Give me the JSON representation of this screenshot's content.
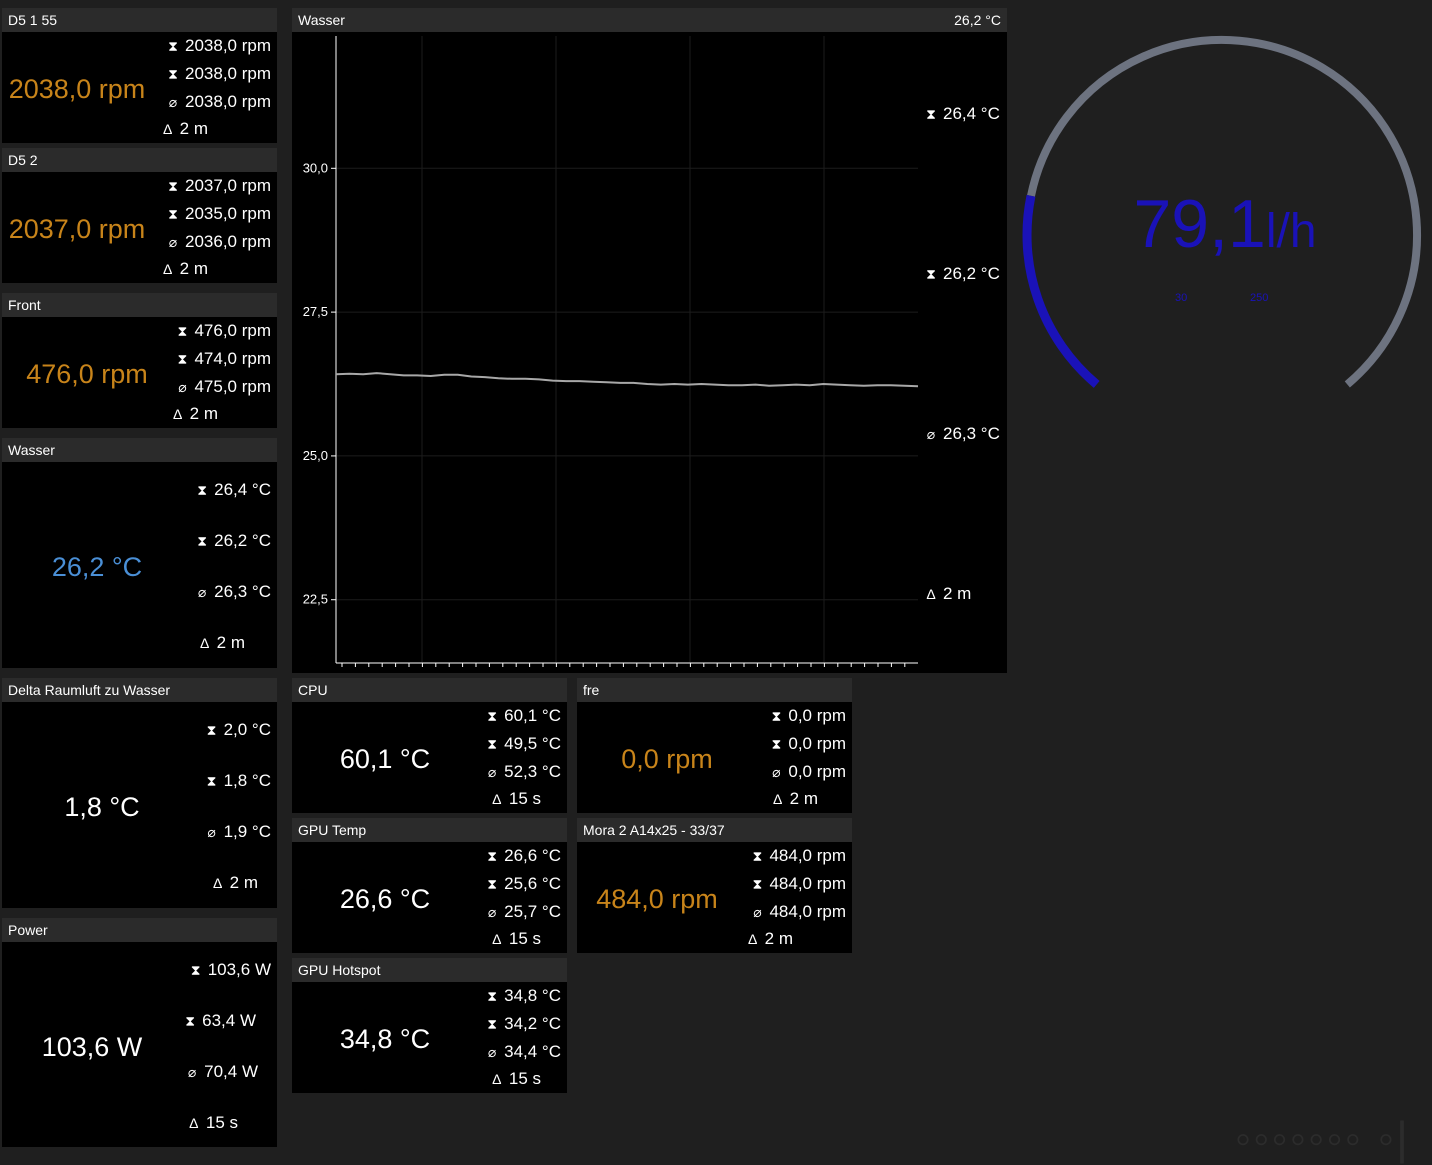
{
  "colors": {
    "rpm": "#c8841a",
    "temp_blue": "#4a8fd6",
    "white": "#ffffff",
    "gauge_fill": "#1a12b8",
    "gauge_track": "#6d7380"
  },
  "icons": {
    "max": "max-hourglass-top-icon",
    "min": "min-hourglass-bottom-icon",
    "avg": "average-diameter-icon",
    "delta": "delta-time-icon"
  },
  "tiles": {
    "d5155": {
      "title": "D5 1 55",
      "value": "2038,0 rpm",
      "max": "2038,0 rpm",
      "min": "2038,0 rpm",
      "avg": "2038,0 rpm",
      "dt": "2 m"
    },
    "d52": {
      "title": "D5 2",
      "value": "2037,0 rpm",
      "max": "2037,0 rpm",
      "min": "2035,0 rpm",
      "avg": "2036,0 rpm",
      "dt": "2 m"
    },
    "front": {
      "title": "Front",
      "value": "476,0 rpm",
      "max": "476,0 rpm",
      "min": "474,0 rpm",
      "avg": "475,0 rpm",
      "dt": "2 m"
    },
    "wasser": {
      "title": "Wasser",
      "value": "26,2 °C",
      "max": "26,4 °C",
      "min": "26,2 °C",
      "avg": "26,3 °C",
      "dt": "2 m"
    },
    "delta": {
      "title": "Delta Raumluft zu Wasser",
      "value": "1,8 °C",
      "max": "2,0 °C",
      "min": "1,8 °C",
      "avg": "1,9 °C",
      "dt": "2 m"
    },
    "power": {
      "title": "Power",
      "value": "103,6 W",
      "max": "103,6 W",
      "min": "63,4 W",
      "avg": "70,4 W",
      "dt": "15 s"
    },
    "cpu": {
      "title": "CPU",
      "value": "60,1 °C",
      "max": "60,1 °C",
      "min": "49,5 °C",
      "avg": "52,3 °C",
      "dt": "15 s"
    },
    "gputemp": {
      "title": "GPU Temp",
      "value": "26,6 °C",
      "max": "26,6 °C",
      "min": "25,6 °C",
      "avg": "25,7 °C",
      "dt": "15 s"
    },
    "gpuhot": {
      "title": "GPU Hotspot",
      "value": "34,8 °C",
      "max": "34,8 °C",
      "min": "34,2 °C",
      "avg": "34,4 °C",
      "dt": "15 s"
    },
    "fre": {
      "title": "fre",
      "value": "0,0 rpm",
      "max": "0,0 rpm",
      "min": "0,0 rpm",
      "avg": "0,0 rpm",
      "dt": "2 m"
    },
    "mora": {
      "title": "Mora 2 A14x25 - 33/37",
      "value": "484,0 rpm",
      "max": "484,0 rpm",
      "min": "484,0 rpm",
      "avg": "484,0 rpm",
      "dt": "2 m"
    }
  },
  "graph": {
    "title": "Wasser",
    "current": "26,2 °C",
    "max": "26,4 °C",
    "min": "26,2 °C",
    "avg": "26,3 °C",
    "dt": "2 m",
    "chart_data": {
      "type": "line",
      "ylim": [
        21.4,
        32.3
      ],
      "yticks": [
        "30,0",
        "27,5",
        "25,0",
        "22,5"
      ],
      "ytick_values": [
        30.0,
        27.5,
        25.0,
        22.5
      ],
      "series": [
        {
          "values": [
            26.42,
            26.43,
            26.42,
            26.44,
            26.42,
            26.4,
            26.4,
            26.39,
            26.41,
            26.41,
            26.38,
            26.37,
            26.35,
            26.34,
            26.34,
            26.33,
            26.31,
            26.3,
            26.3,
            26.29,
            26.28,
            26.27,
            26.27,
            26.25,
            26.24,
            26.25,
            26.24,
            26.25,
            26.24,
            26.23,
            26.23,
            26.24,
            26.22,
            26.23,
            26.24,
            26.23,
            26.25,
            26.24,
            26.23,
            26.22,
            26.23,
            26.23,
            26.22,
            26.21
          ]
        }
      ]
    }
  },
  "gauge": {
    "value": "79,1",
    "unit": "l/h",
    "min_label": "30",
    "max_label": "250",
    "fraction": 0.22
  }
}
